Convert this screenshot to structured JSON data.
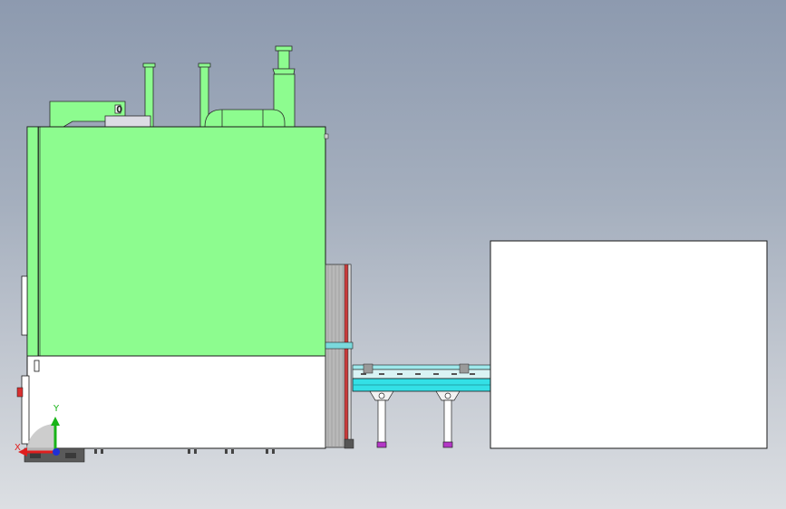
{
  "viewport": {
    "background_top": "#8d9aaf",
    "background_bottom": "#dcdfe3"
  },
  "colors": {
    "machine_green": "#8dfc8f",
    "machine_green_dark": "#3fae45",
    "machine_white": "#ffffff",
    "conveyor_cyan": "#33e0e6",
    "conveyor_dark": "#1c8f96",
    "outline": "#1a1a1a",
    "foot_magenta": "#b437c6",
    "axis_x": "#e01e1e",
    "axis_y": "#18b418",
    "axis_origin": "#1f2fd6"
  },
  "model": {
    "panel_marker": "0",
    "icons": [
      "coordinate-triad-icon"
    ]
  },
  "triad": {
    "y_label": "Y",
    "x_label": "X"
  }
}
